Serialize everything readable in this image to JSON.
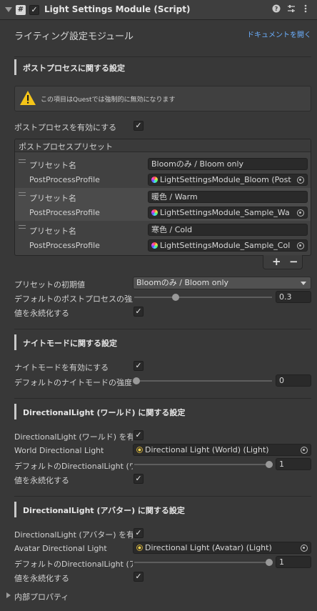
{
  "header": {
    "title": "Light Settings Module (Script)",
    "enabled": true,
    "icons": [
      "help-icon",
      "preset-icon",
      "kebab-menu-icon"
    ]
  },
  "module_title": "ライティング設定モジュール",
  "doc_link": "ドキュメントを開く",
  "postprocess": {
    "section_title": "ポストプロセスに関する設定",
    "warning": "この項目はQuestでは強制的に無効になります",
    "enable_label": "ポストプロセスを有効にする",
    "enable_value": true,
    "list_title": "ポストプロセスプリセット",
    "presets": [
      {
        "name_label": "プリセット名",
        "name_value": "Bloomのみ / Bloom only",
        "profile_label": "PostProcessProfile",
        "profile_value": "LightSettingsModule_Bloom (Post"
      },
      {
        "name_label": "プリセット名",
        "name_value": "暖色 / Warm",
        "profile_label": "PostProcessProfile",
        "profile_value": "LightSettingsModule_Sample_Wa"
      },
      {
        "name_label": "プリセット名",
        "name_value": "寒色 / Cold",
        "profile_label": "PostProcessProfile",
        "profile_value": "LightSettingsModule_Sample_Col"
      }
    ],
    "add_label": "+",
    "remove_label": "−",
    "initial_label": "プリセットの初期値",
    "initial_value": "Bloomのみ / Bloom only",
    "strength_label": "デフォルトのポストプロセスの強度",
    "strength_value": "0.3",
    "persist_label": "値を永続化する",
    "persist_value": true
  },
  "nightmode": {
    "section_title": "ナイトモードに関する設定",
    "enable_label": "ナイトモードを有効にする",
    "enable_value": true,
    "strength_label": "デフォルトのナイトモードの強度",
    "strength_value": "0"
  },
  "world_light": {
    "section_title": "DirectionalLight (ワールド) に関する設定",
    "enable_label": "DirectionalLight (ワールド) を有効",
    "enable_value": true,
    "object_label": "World Directional Light",
    "object_value": "Directional Light (World) (Light)",
    "strength_label": "デフォルトのDirectionalLight (ワー",
    "strength_value": "1",
    "persist_label": "値を永続化する",
    "persist_value": true
  },
  "avatar_light": {
    "section_title": "DirectionalLight (アバター) に関する設定",
    "enable_label": "DirectionalLight (アバター) を有効",
    "enable_value": true,
    "object_label": "Avatar Directional Light",
    "object_value": "Directional Light (Avatar) (Light)",
    "strength_label": "デフォルトのDirectionalLight (アバ",
    "strength_value": "1",
    "persist_label": "値を永続化する",
    "persist_value": true
  },
  "internal_label": "内部プロパティ",
  "check_glyph": "✓",
  "colors": {
    "accent_link": "#6cb0ff",
    "warning": "#f5c518"
  }
}
